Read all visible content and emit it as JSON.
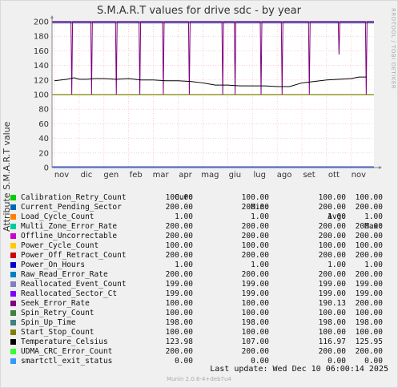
{
  "chart_data": {
    "type": "line",
    "title": "S.M.A.R.T values for drive sdc - by year",
    "ylabel": "Attribute S.M.A.R.T value",
    "side_label": "RRDTOOL / TOBI OETIKER",
    "ylim": [
      0,
      200
    ],
    "yticks": [
      0,
      20,
      40,
      60,
      80,
      100,
      120,
      140,
      160,
      180,
      200
    ],
    "months": [
      "nov",
      "dic",
      "gen",
      "feb",
      "mar",
      "apr",
      "mag",
      "giu",
      "lug",
      "ago",
      "set",
      "ott",
      "nov"
    ],
    "grid": true,
    "legend_headers": [
      "Cur:",
      "Min:",
      "Avg:",
      "Max:"
    ],
    "series": [
      {
        "name": "Calibration_Retry_Count",
        "color": "#00cc00",
        "cur": "100.00",
        "min": "100.00",
        "avg": "100.00",
        "max": "100.00"
      },
      {
        "name": "Current_Pending_Sector",
        "color": "#0066b3",
        "cur": "200.00",
        "min": "200.00",
        "avg": "200.00",
        "max": "200.00"
      },
      {
        "name": "Load_Cycle_Count",
        "color": "#ff8000",
        "cur": "1.00",
        "min": "1.00",
        "avg": "1.00",
        "max": "1.00"
      },
      {
        "name": "Multi_Zone_Error_Rate",
        "color": "#00cc99",
        "cur": "200.00",
        "min": "200.00",
        "avg": "200.00",
        "max": "200.00"
      },
      {
        "name": "Offline_Uncorrectable",
        "color": "#cc00cc",
        "cur": "200.00",
        "min": "200.00",
        "avg": "200.00",
        "max": "200.00"
      },
      {
        "name": "Power_Cycle_Count",
        "color": "#ffcc00",
        "cur": "100.00",
        "min": "100.00",
        "avg": "100.00",
        "max": "100.00"
      },
      {
        "name": "Power_Off_Retract_Count",
        "color": "#cc0000",
        "cur": "200.00",
        "min": "200.00",
        "avg": "200.00",
        "max": "200.00"
      },
      {
        "name": "Power_On_Hours",
        "color": "#0000cc",
        "cur": "1.00",
        "min": "1.00",
        "avg": "1.00",
        "max": "1.00"
      },
      {
        "name": "Raw_Read_Error_Rate",
        "color": "#0080c0",
        "cur": "200.00",
        "min": "200.00",
        "avg": "200.00",
        "max": "200.00"
      },
      {
        "name": "Reallocated_Event_Count",
        "color": "#8080c0",
        "cur": "199.00",
        "min": "199.00",
        "avg": "199.00",
        "max": "199.00"
      },
      {
        "name": "Reallocated_Sector_Ct",
        "color": "#8000ff",
        "cur": "199.00",
        "min": "199.00",
        "avg": "199.00",
        "max": "199.00"
      },
      {
        "name": "Seek_Error_Rate",
        "color": "#800080",
        "cur": "100.00",
        "min": "100.00",
        "avg": "190.13",
        "max": "200.00"
      },
      {
        "name": "Spin_Retry_Count",
        "color": "#408040",
        "cur": "100.00",
        "min": "100.00",
        "avg": "100.00",
        "max": "100.00"
      },
      {
        "name": "Spin_Up_Time",
        "color": "#408080",
        "cur": "198.00",
        "min": "198.00",
        "avg": "198.00",
        "max": "198.00"
      },
      {
        "name": "Start_Stop_Count",
        "color": "#808000",
        "cur": "100.00",
        "min": "100.00",
        "avg": "100.00",
        "max": "100.00"
      },
      {
        "name": "Temperature_Celsius",
        "color": "#000000",
        "cur": "123.98",
        "min": "107.00",
        "avg": "116.97",
        "max": "125.95"
      },
      {
        "name": "UDMA_CRC_Error_Count",
        "color": "#33ff33",
        "cur": "200.00",
        "min": "200.00",
        "avg": "200.00",
        "max": "200.00"
      },
      {
        "name": "smartctl_exit_status",
        "color": "#3399ff",
        "cur": "0.00",
        "min": "0.00",
        "avg": "0.00",
        "max": "0.00"
      }
    ],
    "seek_error_drops": [
      {
        "month": 0.7,
        "value": 100
      },
      {
        "month": 1.5,
        "value": 100
      },
      {
        "month": 2.5,
        "value": 100
      },
      {
        "month": 3.45,
        "value": 100
      },
      {
        "month": 4.4,
        "value": 100
      },
      {
        "month": 5.45,
        "value": 100
      },
      {
        "month": 6.8,
        "value": 100
      },
      {
        "month": 7.3,
        "value": 100
      },
      {
        "month": 8.35,
        "value": 100
      },
      {
        "month": 9.2,
        "value": 100
      },
      {
        "month": 10.3,
        "value": 100
      },
      {
        "month": 11.5,
        "value": 155
      },
      {
        "month": 12.6,
        "value": 100
      }
    ],
    "temperature": [
      [
        0,
        119
      ],
      [
        0.5,
        121
      ],
      [
        0.8,
        123
      ],
      [
        1.0,
        121
      ],
      [
        1.3,
        121
      ],
      [
        1.6,
        122
      ],
      [
        2.0,
        122
      ],
      [
        2.5,
        121
      ],
      [
        3.0,
        122
      ],
      [
        3.5,
        120
      ],
      [
        4.0,
        120
      ],
      [
        4.5,
        119
      ],
      [
        5.0,
        119
      ],
      [
        5.5,
        118
      ],
      [
        6.0,
        116
      ],
      [
        6.5,
        113
      ],
      [
        7.0,
        113
      ],
      [
        7.5,
        112
      ],
      [
        8.0,
        112
      ],
      [
        8.5,
        112
      ],
      [
        9.0,
        111
      ],
      [
        9.5,
        111
      ],
      [
        10.0,
        116
      ],
      [
        10.5,
        118
      ],
      [
        11.0,
        120
      ],
      [
        11.5,
        121
      ],
      [
        12.0,
        122
      ],
      [
        12.3,
        124
      ],
      [
        12.6,
        124
      ]
    ]
  },
  "footer": {
    "last_update": "Last update:  Wed Dec 10 06:00:14 2025",
    "munin": "Munin 2.0.6-4+deb7u4"
  }
}
